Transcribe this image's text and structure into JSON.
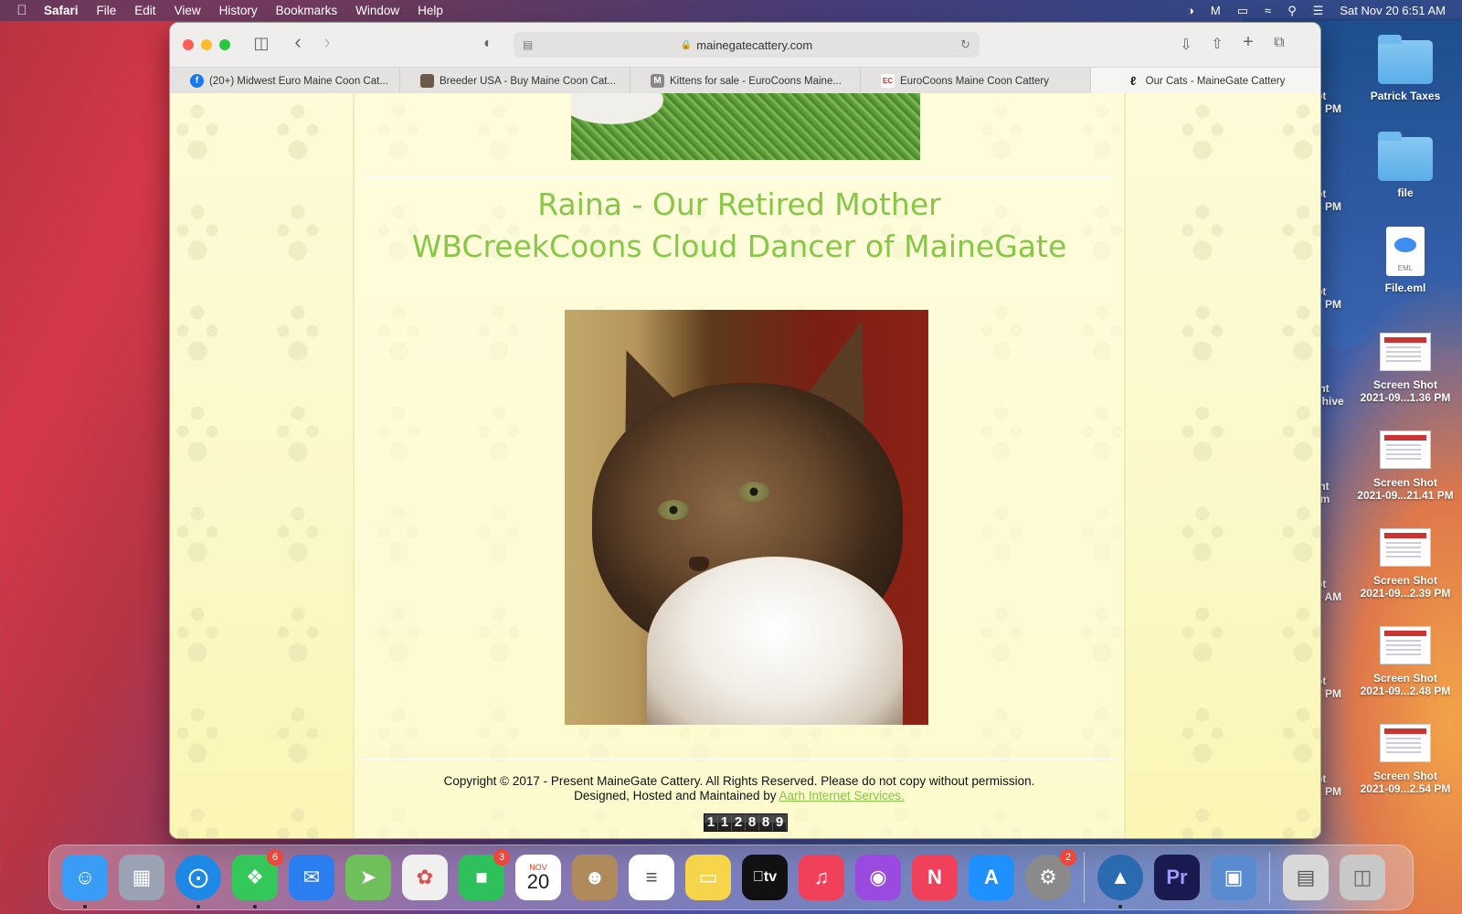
{
  "menubar": {
    "app": "Safari",
    "items": [
      "File",
      "Edit",
      "View",
      "History",
      "Bookmarks",
      "Window",
      "Help"
    ],
    "datetime": "Sat Nov 20  6:51 AM"
  },
  "desktop": {
    "icons": [
      {
        "name": "Patrick Taxes",
        "type": "folder"
      },
      {
        "name": "file",
        "type": "folder"
      },
      {
        "name": "File.eml",
        "type": "eml",
        "badge": "EML"
      },
      {
        "name_line1": "Screen Shot",
        "name_line2": "2021-09...1.36 PM"
      },
      {
        "name_line1": "Screen Shot",
        "name_line2": "2021-09...21.41 PM"
      },
      {
        "name_line1": "Screen Shot",
        "name_line2": "2021-09...2.39 PM"
      },
      {
        "name_line1": "Screen Shot",
        "name_line2": "2021-09...2.48 PM"
      },
      {
        "name_line1": "Screen Shot",
        "name_line2": "2021-09...2.54 PM"
      }
    ],
    "partials": [
      "ot",
      "9 PM",
      "ot",
      "3 PM",
      "ot",
      "7 PM",
      "int",
      "chive",
      "int",
      "rm",
      "ot",
      "0 AM",
      "ot",
      "7 PM",
      "ot",
      "1 PM"
    ]
  },
  "browser": {
    "url": "mainegatecattery.com",
    "tabs": [
      {
        "label": "(20+) Midwest Euro Maine Coon Cat...",
        "fav_color": "#1877f2",
        "fav_glyph": "f"
      },
      {
        "label": "Breeder USA - Buy Maine Coon Cat...",
        "fav_color": "#6b5a4a",
        "fav_glyph": ""
      },
      {
        "label": "Kittens for sale - EuroCoons Maine...",
        "fav_color": "#888888",
        "fav_glyph": "M"
      },
      {
        "label": "EuroCoons Maine Coon Cattery",
        "fav_color": "#c0392b",
        "fav_glyph": "EC"
      },
      {
        "label": "Our Cats - MaineGate Cattery",
        "fav_color": "#222222",
        "fav_glyph": "",
        "active": true
      }
    ]
  },
  "page": {
    "title_line1": "Raina - Our Retired Mother",
    "title_line2": "WBCreekCoons Cloud Dancer of MaineGate",
    "footer_line1": "Copyright © 2017 - Present  MaineGate Cattery. All Rights Reserved. Please do not copy without permission.",
    "footer_line2_prefix": "Designed, Hosted and Maintained by ",
    "footer_link": "Aarh Internet Services.",
    "counter_digits": [
      "1",
      "1",
      "2",
      "8",
      "8",
      "9"
    ],
    "title_color": "#86c846"
  },
  "dock": {
    "apps": [
      {
        "name": "Finder",
        "color": "#3a9df5",
        "glyph": "☺",
        "running": true
      },
      {
        "name": "Launchpad",
        "color": "#9aa2b4",
        "glyph": "▦"
      },
      {
        "name": "Safari",
        "color": "#1e88e5",
        "glyph": "⊘",
        "running": true
      },
      {
        "name": "Messages",
        "color": "#34c759",
        "glyph": "✉",
        "badge": "6",
        "running": true
      },
      {
        "name": "Mail",
        "color": "#2a7ef0",
        "glyph": "✉"
      },
      {
        "name": "Maps",
        "color": "#6fbf5a",
        "glyph": "➤"
      },
      {
        "name": "Photos",
        "color": "#f0f0f0",
        "glyph": "✿"
      },
      {
        "name": "FaceTime",
        "color": "#2ec05a",
        "glyph": "■",
        "badge": "3"
      },
      {
        "name": "Calendar",
        "color": "#ffffff",
        "month": "NOV",
        "day": "20"
      },
      {
        "name": "Contacts",
        "color": "#b08a5a",
        "glyph": "☻"
      },
      {
        "name": "Reminders",
        "color": "#ffffff",
        "glyph": "≡"
      },
      {
        "name": "Notes",
        "color": "#f7d54a",
        "glyph": "▭"
      },
      {
        "name": "TV",
        "color": "#111111",
        "glyph": "tv"
      },
      {
        "name": "Music",
        "color": "#f0405a",
        "glyph": "♫"
      },
      {
        "name": "Podcasts",
        "color": "#9b4ae0",
        "glyph": "◉"
      },
      {
        "name": "News",
        "color": "#f0405a",
        "glyph": "N"
      },
      {
        "name": "App Store",
        "color": "#1e90ff",
        "glyph": "A"
      },
      {
        "name": "System Preferences",
        "color": "#8a8a8a",
        "glyph": "⚙",
        "badge": "2"
      },
      {
        "name": "Monterey Installer",
        "color": "#2a6ab0",
        "glyph": "▲",
        "running": true
      },
      {
        "name": "Premiere Pro",
        "color": "#1a1a50",
        "glyph": "Pr"
      },
      {
        "name": "Preview",
        "color": "#5a8ad0",
        "glyph": "▣"
      },
      {
        "name": "Documents",
        "color": "#d8d8d8",
        "glyph": "▤"
      },
      {
        "name": "Trash",
        "color": "#c8c8c8",
        "glyph": "🗑"
      }
    ]
  }
}
